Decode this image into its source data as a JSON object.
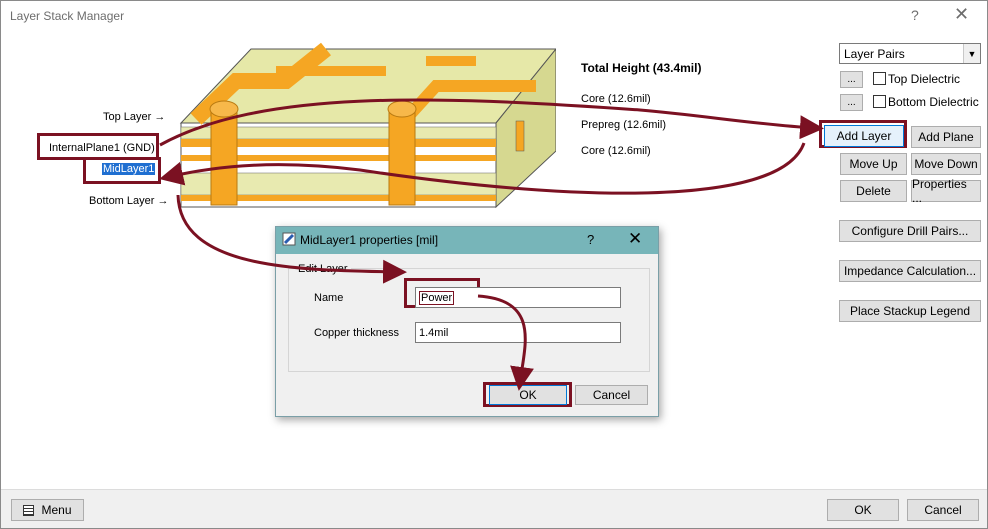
{
  "window": {
    "title": "Layer Stack Manager",
    "help_glyph": "?",
    "close_glyph": "✕"
  },
  "stack": {
    "total_height": "Total Height (43.4mil)",
    "right_labels": [
      "Core (12.6mil)",
      "Prepreg (12.6mil)",
      "Core (12.6mil)"
    ],
    "left_labels": {
      "top_layer": "Top Layer",
      "internal_plane": "InternalPlane1 (GND)",
      "mid_layer": "MidLayer1",
      "bottom_layer": "Bottom Layer"
    }
  },
  "side_panel": {
    "layer_pairs": "Layer Pairs",
    "ellipsis": "...",
    "top_dielectric": "Top Dielectric",
    "bottom_dielectric": "Bottom Dielectric",
    "buttons": {
      "add_layer": "Add Layer",
      "add_plane": "Add Plane",
      "move_up": "Move Up",
      "move_down": "Move Down",
      "delete": "Delete",
      "properties": "Properties ...",
      "configure_drill_pairs": "Configure Drill Pairs...",
      "impedance_calculation": "Impedance Calculation...",
      "place_stackup_legend": "Place Stackup Legend"
    }
  },
  "bottom": {
    "menu": "Menu",
    "ok": "OK",
    "cancel": "Cancel"
  },
  "dialog": {
    "title": "MidLayer1 properties [mil]",
    "help_glyph": "?",
    "close_glyph": "✕",
    "group_caption": "Edit Layer",
    "name_label": "Name",
    "name_value": "Power",
    "copper_label": "Copper thickness",
    "copper_value": "1.4mil",
    "ok": "OK",
    "cancel": "Cancel"
  },
  "colors": {
    "highlight": "#7b1122",
    "copper": "#f5a623",
    "dielectric": "#e8eab0",
    "titlebar": "#77b5b9"
  }
}
